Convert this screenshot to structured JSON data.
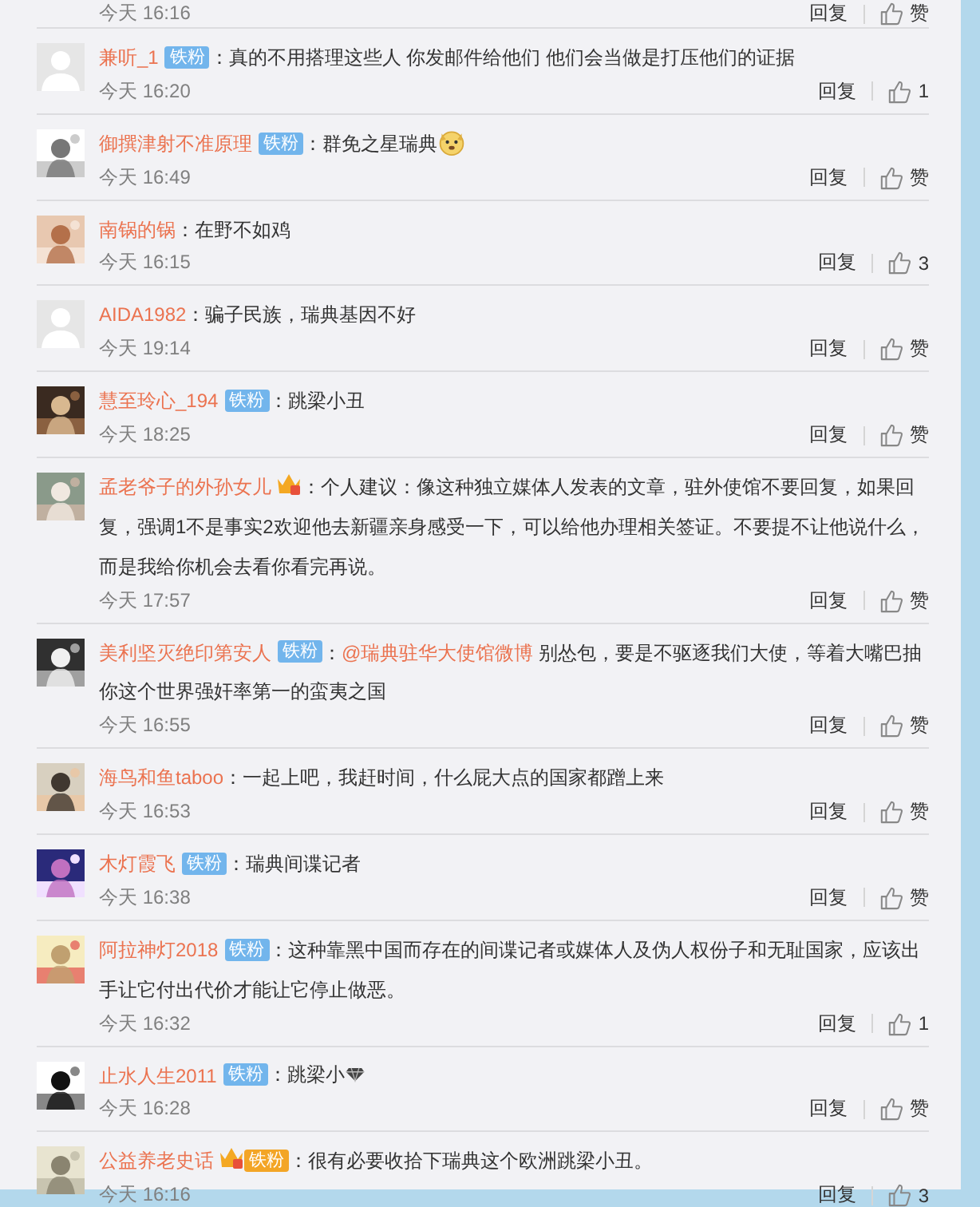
{
  "top_partial": {
    "time": "今天 16:16",
    "reply": "回复",
    "likes": "赞"
  },
  "comments": [
    {
      "avatar": {
        "kind": "default"
      },
      "name": "兼听_1",
      "badges": [
        {
          "kind": "fan",
          "label": "铁粉"
        }
      ],
      "colon": "：",
      "text": "真的不用搭理这些人 你发邮件给他们 他们会当做是打压他们的证据",
      "time": "今天 16:20",
      "reply": "回复",
      "likes": "1"
    },
    {
      "avatar": {
        "kind": "sketch"
      },
      "name": "御撰津射不准原理",
      "badges": [
        {
          "kind": "fan",
          "label": "铁粉"
        }
      ],
      "colon": "：",
      "text": "群免之星瑞典",
      "emoji": {
        "kind": "face"
      },
      "time": "今天 16:49",
      "reply": "回复",
      "likes": "赞"
    },
    {
      "avatar": {
        "kind": "warm"
      },
      "name": "南锅的锅",
      "colon": "：",
      "text": "在野不如鸡",
      "time": "今天 16:15",
      "reply": "回复",
      "likes": "3"
    },
    {
      "avatar": {
        "kind": "default"
      },
      "name": "AIDA1982",
      "colon": "：",
      "text": "骗子民族，瑞典基因不好",
      "time": "今天 19:14",
      "reply": "回复",
      "likes": "赞"
    },
    {
      "avatar": {
        "kind": "dark"
      },
      "name": "慧至玲心_194",
      "badges": [
        {
          "kind": "fan",
          "label": "铁粉"
        }
      ],
      "colon": "：",
      "text": "跳梁小丑",
      "time": "今天 18:25",
      "reply": "回复",
      "likes": "赞"
    },
    {
      "avatar": {
        "kind": "person"
      },
      "name": "孟老爷子的外孙女儿",
      "badges": [
        {
          "kind": "vip"
        }
      ],
      "colon": "：",
      "text": "个人建议：像这种独立媒体人发表的文章，驻外使馆不要回复，如果回复，强调1不是事实2欢迎他去新疆亲身感受一下，可以给他办理相关签证。不要提不让他说什么，而是我给你机会去看你看完再说。",
      "time": "今天 17:57",
      "reply": "回复",
      "likes": "赞"
    },
    {
      "avatar": {
        "kind": "dog"
      },
      "name": "美利坚灭绝印第安人",
      "badges": [
        {
          "kind": "fan",
          "label": "铁粉"
        }
      ],
      "colon": "：",
      "mention": "@瑞典驻华大使馆微博",
      "text": " 别怂包，要是不驱逐我们大使，等着大嘴巴抽你这个世界强奸率第一的蛮夷之国",
      "time": "今天 16:55",
      "reply": "回复",
      "likes": "赞"
    },
    {
      "avatar": {
        "kind": "couple"
      },
      "name": "海鸟和鱼taboo",
      "colon": "：",
      "text": "一起上吧，我赶时间，什么屁大点的国家都蹭上来",
      "time": "今天 16:53",
      "reply": "回复",
      "likes": "赞"
    },
    {
      "avatar": {
        "kind": "night"
      },
      "name": "木灯霞飞",
      "badges": [
        {
          "kind": "fan",
          "label": "铁粉"
        }
      ],
      "colon": "：",
      "text": "瑞典间谍记者",
      "time": "今天 16:38",
      "reply": "回复",
      "likes": "赞"
    },
    {
      "avatar": {
        "kind": "cream"
      },
      "name": "阿拉神灯2018",
      "badges": [
        {
          "kind": "fan",
          "label": "铁粉"
        }
      ],
      "colon": "：",
      "text": "这种靠黑中国而存在的间谍记者或媒体人及伪人权份子和无耻国家，应该出手让它付出代价才能让它停止做恶。",
      "time": "今天 16:32",
      "reply": "回复",
      "likes": "1"
    },
    {
      "avatar": {
        "kind": "panda"
      },
      "name": "止水人生2011",
      "badges": [
        {
          "kind": "fan",
          "label": "铁粉"
        }
      ],
      "colon": "：",
      "text": "跳梁小",
      "emoji": {
        "kind": "gem"
      },
      "time": "今天 16:28",
      "reply": "回复",
      "likes": "赞"
    },
    {
      "avatar": {
        "kind": "paper"
      },
      "name": "公益养老史话",
      "badges": [
        {
          "kind": "vip-fan",
          "label": "铁粉"
        }
      ],
      "colon": "：",
      "text": "很有必要收拾下瑞典这个欧洲跳梁小丑。",
      "time": "今天 16:16",
      "reply": "回复",
      "likes": "3"
    }
  ]
}
